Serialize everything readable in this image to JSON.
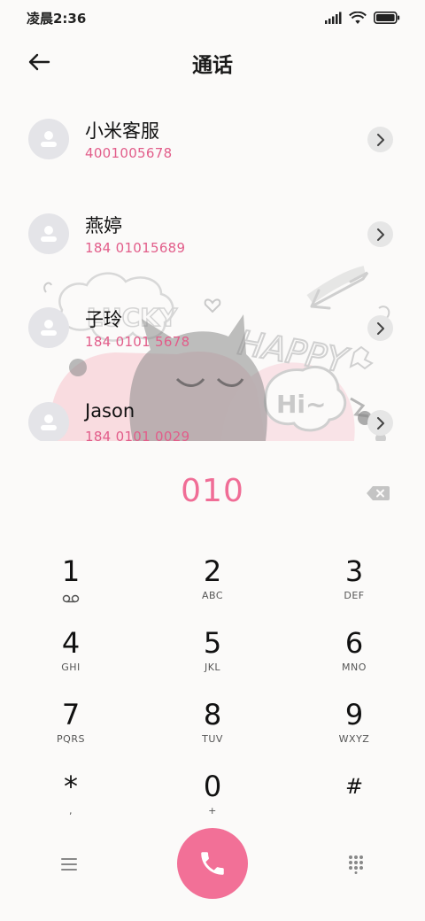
{
  "status_bar": {
    "time": "凌晨2:36"
  },
  "header": {
    "title": "通话"
  },
  "contacts": [
    {
      "name": "小米客服",
      "number": "4001005678"
    },
    {
      "name": "燕婷",
      "number": "184 01015689"
    },
    {
      "name": "子玲",
      "number": "184 0101 5678"
    },
    {
      "name": "Jason",
      "number": "184 0101 0029"
    }
  ],
  "background_art": {
    "words": [
      "LUCKY",
      "HAPPY",
      "Hi~"
    ]
  },
  "dial": {
    "entered_number": "010"
  },
  "keypad": [
    {
      "digit": "1",
      "letters": "",
      "icon": "voicemail-icon"
    },
    {
      "digit": "2",
      "letters": "ABC"
    },
    {
      "digit": "3",
      "letters": "DEF"
    },
    {
      "digit": "4",
      "letters": "GHI"
    },
    {
      "digit": "5",
      "letters": "JKL"
    },
    {
      "digit": "6",
      "letters": "MNO"
    },
    {
      "digit": "7",
      "letters": "PQRS"
    },
    {
      "digit": "8",
      "letters": "TUV"
    },
    {
      "digit": "9",
      "letters": "WXYZ"
    },
    {
      "digit": "*",
      "letters": ","
    },
    {
      "digit": "0",
      "letters": "+"
    },
    {
      "digit": "#",
      "letters": ""
    }
  ],
  "colors": {
    "accent": "#f06d96",
    "number_text": "#e25d8a",
    "call_button": "#f27097",
    "avatar_bg": "#e4e4e8"
  }
}
